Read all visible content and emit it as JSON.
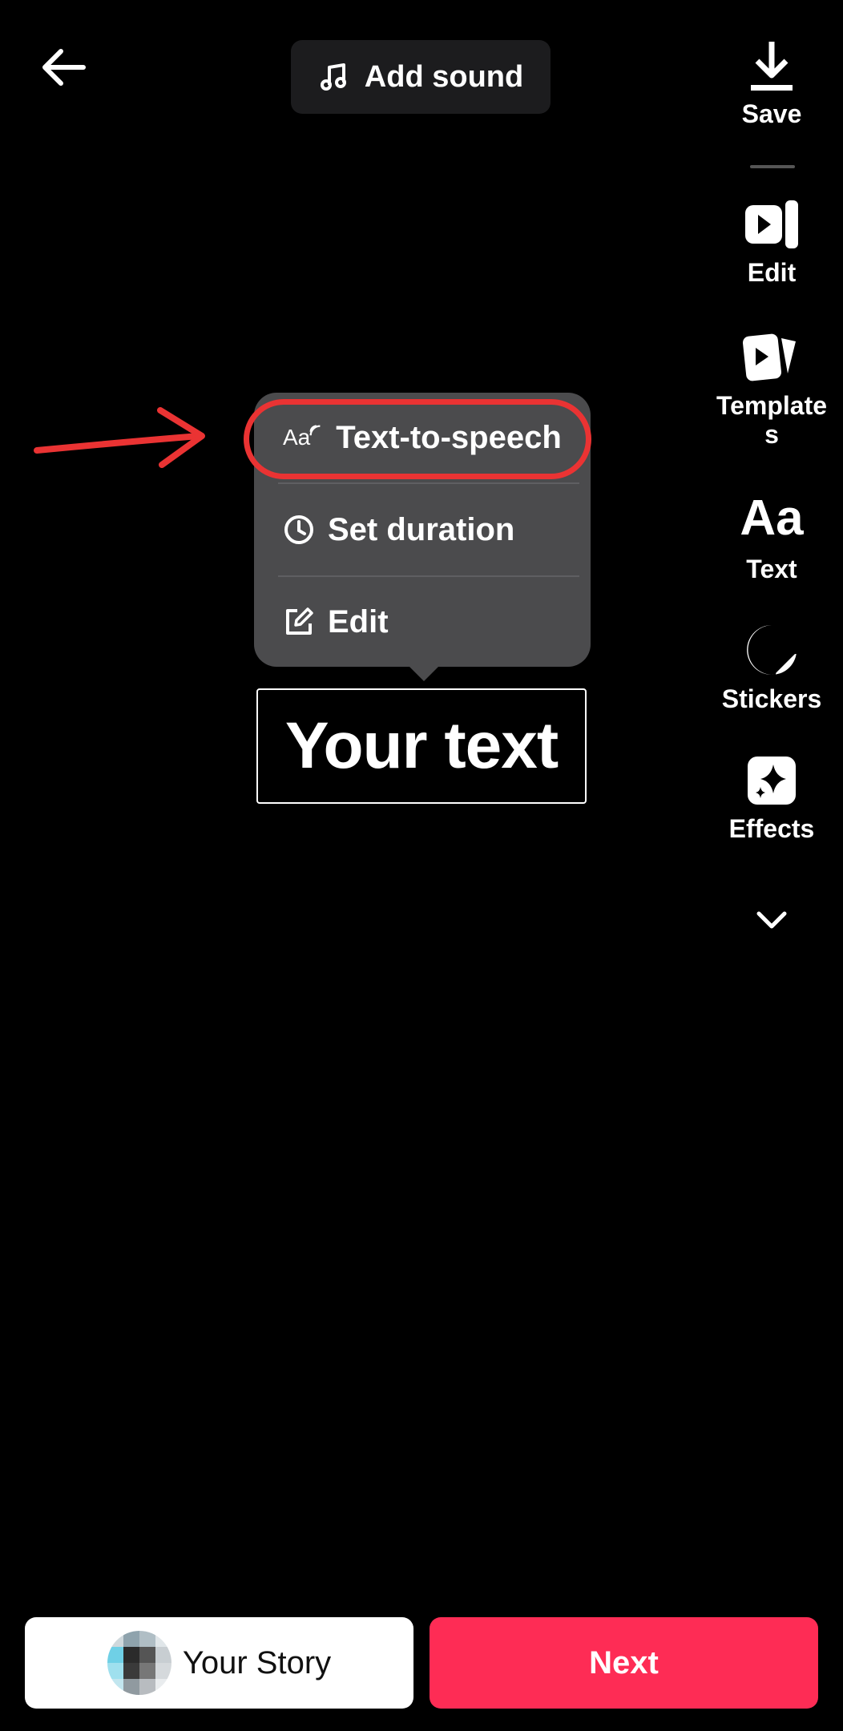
{
  "header": {
    "back_icon": "arrow-left-icon",
    "add_sound": {
      "icon": "music-note-icon",
      "label": "Add sound"
    }
  },
  "rail": {
    "items": [
      {
        "id": "save",
        "icon": "download-icon",
        "label": "Save"
      },
      {
        "id": "edit",
        "icon": "edit-clip-icon",
        "label": "Edit"
      },
      {
        "id": "templates",
        "icon": "templates-icon",
        "label_line1": "Template",
        "label_line2": "s"
      },
      {
        "id": "text",
        "icon": "text-aa-icon",
        "icon_text": "Aa",
        "label": "Text"
      },
      {
        "id": "stickers",
        "icon": "sticker-icon",
        "label": "Stickers"
      },
      {
        "id": "effects",
        "icon": "sparkle-effects-icon",
        "label": "Effects"
      },
      {
        "id": "more",
        "icon": "chevron-down-icon"
      }
    ]
  },
  "popup_menu": {
    "items": [
      {
        "id": "tts",
        "icon": "text-to-speech-icon",
        "icon_text": "Aa",
        "label": "Text-to-speech"
      },
      {
        "id": "duration",
        "icon": "clock-icon",
        "label": "Set duration"
      },
      {
        "id": "edit",
        "icon": "edit-square-icon",
        "label": "Edit"
      }
    ]
  },
  "annotation": {
    "color": "#ea3333"
  },
  "canvas": {
    "text_overlay": "Your text"
  },
  "footer": {
    "story_button": {
      "label": "Your Story"
    },
    "next_button": {
      "label": "Next"
    }
  },
  "colors": {
    "accent": "#fe2c55",
    "background": "#000000",
    "popup": "#4b4b4d"
  }
}
